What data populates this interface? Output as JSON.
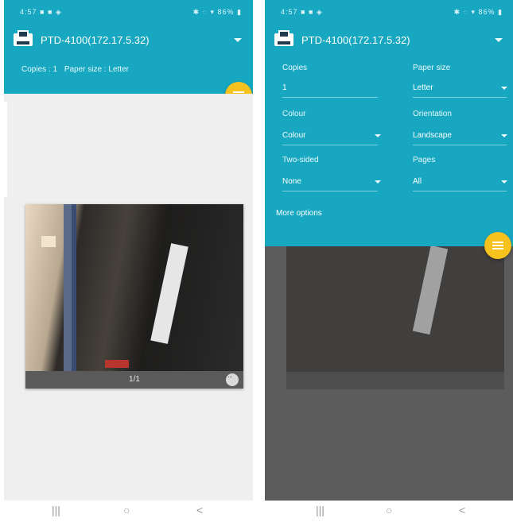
{
  "status_bar": {
    "left_text": "4:57 ■ ■ ◈",
    "right_text": "✱ ◌ ▾ 86% ▮"
  },
  "printer": {
    "name": "PTD-4100(172.17.5.32)",
    "icon": "printer-icon",
    "summary_copies": "Copies : 1",
    "summary_paper": "Paper size : Letter"
  },
  "preview": {
    "page_label": "1/1",
    "more_icon": "more-horizontal-icon"
  },
  "print_fab": {
    "icon": "print-icon",
    "color": "#f7c21d"
  },
  "options": {
    "copies_label": "Copies",
    "copies_value": "1",
    "paper_size_label": "Paper size",
    "paper_size_value": "Letter",
    "color_label": "Colour",
    "color_value": "Colour",
    "orientation_label": "Orientation",
    "orientation_value": "Landscape",
    "two_sided_label": "Two-sided",
    "two_sided_value": "None",
    "pages_label": "Pages",
    "pages_value": "All",
    "more_options": "More options"
  },
  "nav": {
    "recent": "|||",
    "home": "○",
    "back": "<"
  },
  "colors": {
    "accent": "#17a7c1",
    "fab": "#f7c21d",
    "background": "#efefef"
  }
}
